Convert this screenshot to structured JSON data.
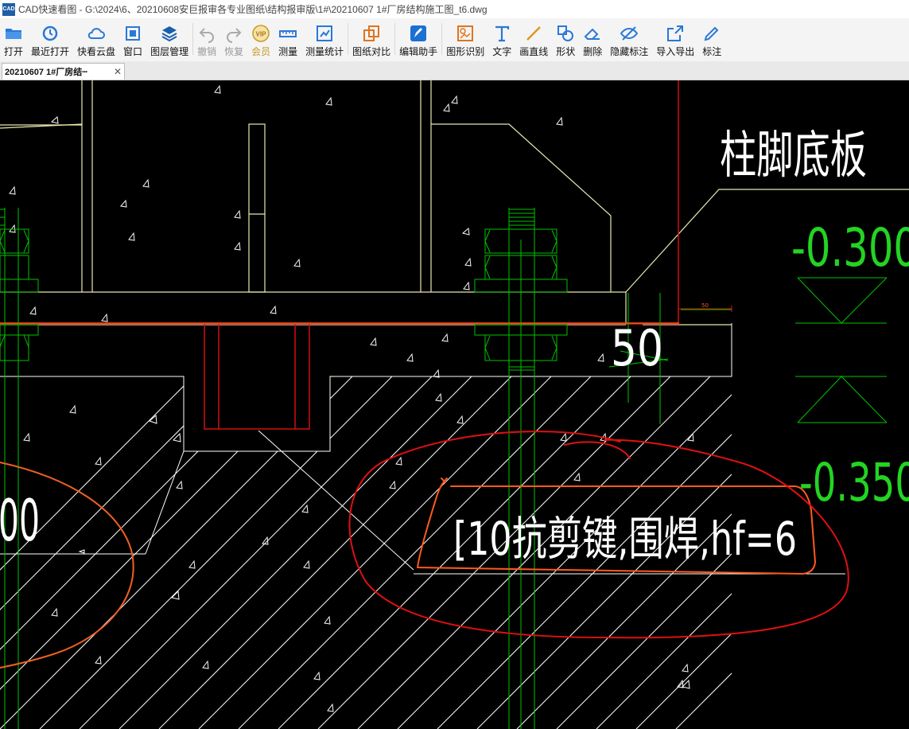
{
  "window": {
    "title": "CAD快速看图 - G:\\2024\\6、20210608安巨报审各专业图纸\\结构报审版\\1#\\20210607  1#厂房结构施工图_t6.dwg",
    "logo_text": "CAD"
  },
  "toolbar": {
    "items": [
      {
        "label": "打开",
        "icon": "folder-icon"
      },
      {
        "label": "最近打开",
        "icon": "recent-icon"
      },
      {
        "label": "快看云盘",
        "icon": "cloud-icon"
      },
      {
        "label": "窗口",
        "icon": "window-icon"
      },
      {
        "label": "图层管理",
        "icon": "layers-icon"
      },
      {
        "label": "撤销",
        "icon": "undo-icon"
      },
      {
        "label": "恢复",
        "icon": "redo-icon"
      },
      {
        "label": "会员",
        "icon": "vip-icon",
        "badge": "VIP"
      },
      {
        "label": "测量",
        "icon": "ruler-icon"
      },
      {
        "label": "测量统计",
        "icon": "measure-stats-icon"
      },
      {
        "label": "图纸对比",
        "icon": "compare-icon"
      },
      {
        "label": "编辑助手",
        "icon": "edit-assistant-icon"
      },
      {
        "label": "图形识别",
        "icon": "shape-recognize-icon"
      },
      {
        "label": "文字",
        "icon": "text-icon"
      },
      {
        "label": "画直线",
        "icon": "line-icon"
      },
      {
        "label": "形状",
        "icon": "shape-icon"
      },
      {
        "label": "删除",
        "icon": "eraser-icon"
      },
      {
        "label": "隐藏标注",
        "icon": "hide-icon"
      },
      {
        "label": "导入导出",
        "icon": "import-export-icon"
      },
      {
        "label": "标注",
        "icon": "annotate-icon"
      }
    ]
  },
  "tabs": [
    {
      "label": "20210607  1#厂房结┅",
      "close": "✕"
    }
  ],
  "drawing": {
    "title_text": "柱脚底板",
    "elev_1": "-0.300",
    "elev_2": "-0.350",
    "dim_50": "50",
    "dim_small_50": "50",
    "left_text": "00",
    "note_text": "[10抗剪键,围焊,hf=6",
    "colors": {
      "white": "#ffffff",
      "green": "#00c400",
      "red": "#e01010",
      "orange": "#ff5a1e",
      "yellow": "#e8e8b0",
      "bright_green": "#23d423"
    }
  }
}
